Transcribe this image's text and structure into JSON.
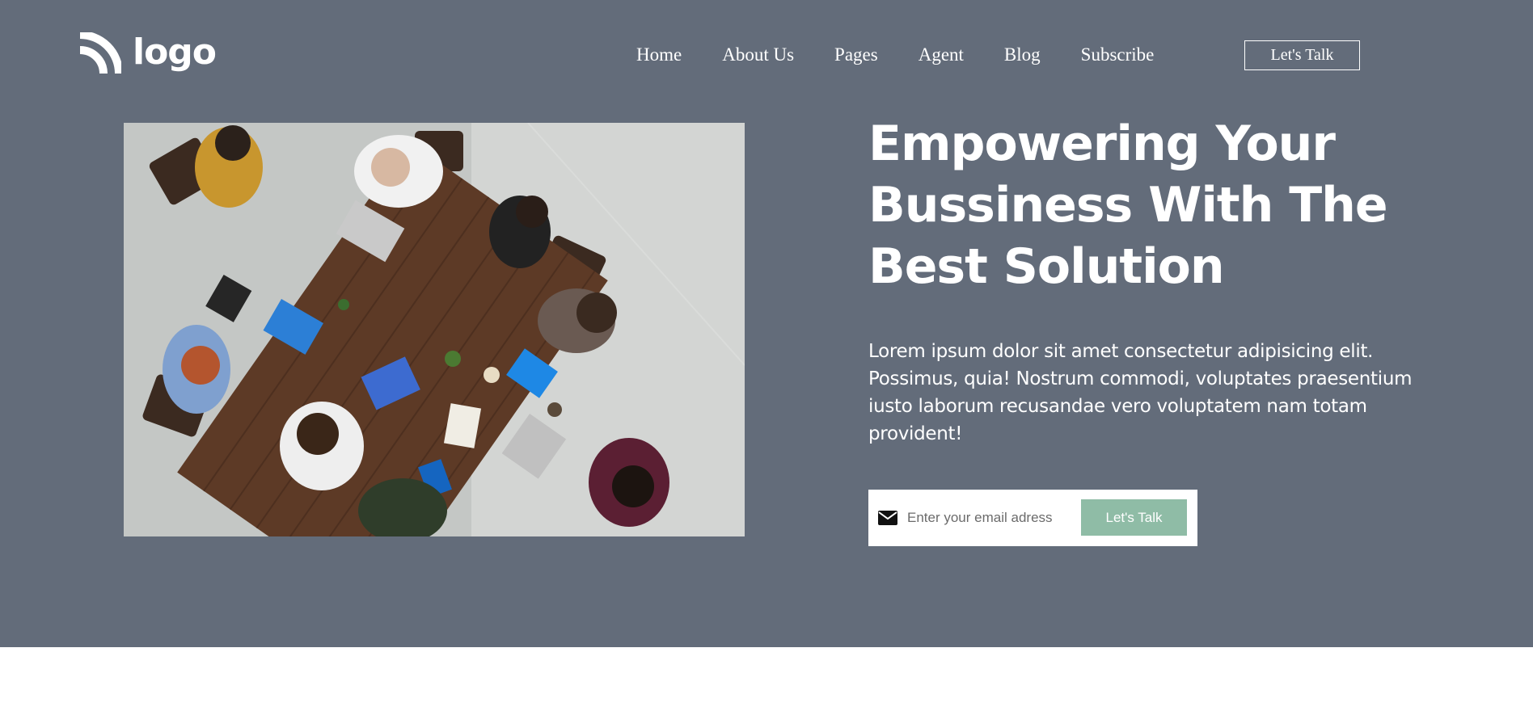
{
  "header": {
    "logo_text": "logo",
    "logo_icon": "signal-arcs-icon",
    "nav": [
      {
        "label": "Home"
      },
      {
        "label": "About Us"
      },
      {
        "label": "Pages"
      },
      {
        "label": "Agent"
      },
      {
        "label": "Blog"
      },
      {
        "label": "Subscribe"
      }
    ],
    "cta_label": "Let's Talk"
  },
  "hero": {
    "title": "Empowering Your Bussiness With The Best Solution",
    "description": "Lorem ipsum dolor sit amet consectetur adipisicing elit. Possimus, quia! Nostrum commodi, voluptates praesentium iusto laborum recusandae vero voluptatem nam totam provident!",
    "email_placeholder": "Enter your email adress",
    "email_icon": "envelope-icon",
    "submit_label": "Let's Talk"
  },
  "colors": {
    "hero_background": "#636c7a",
    "accent": "#8fbca6",
    "text": "#ffffff"
  }
}
